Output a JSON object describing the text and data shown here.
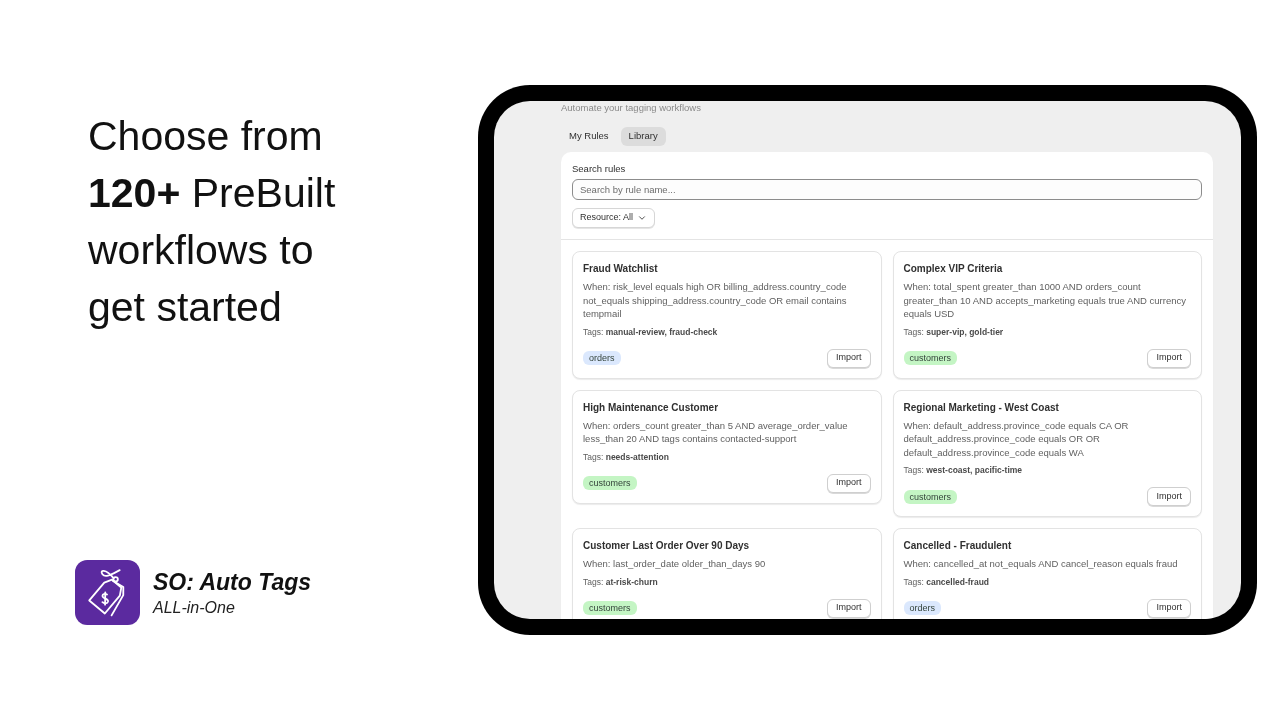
{
  "promo": {
    "headline": "Choose from **120+** PreBuilt workflows to get started"
  },
  "brand": {
    "name": "SO: Auto Tags",
    "tagline": "ALL-in-One"
  },
  "app": {
    "subtitle": "Automate your tagging workflows",
    "tabs": [
      {
        "label": "My Rules",
        "selected": false
      },
      {
        "label": "Library",
        "selected": true
      }
    ],
    "search": {
      "label": "Search rules",
      "placeholder": "Search by rule name..."
    },
    "filter": {
      "label": "Resource: All"
    },
    "rules": [
      {
        "title": "Fraud Watchlist",
        "condition": "When: risk_level equals high OR billing_address.country_code not_equals shipping_address.country_code OR email contains tempmail",
        "tags": "Tags: **manual-review, fraud-check**",
        "resource": {
          "label": "orders",
          "color": "#dbe8fd"
        },
        "action": "Import"
      },
      {
        "title": "Complex VIP Criteria",
        "condition": "When: total_spent greater_than 1000 AND orders_count greater_than 10 AND accepts_marketing equals true AND currency equals USD",
        "tags": "Tags: **super-vip, gold-tier**",
        "resource": {
          "label": "customers",
          "color": "#c4f5c4"
        },
        "action": "Import"
      },
      {
        "title": "High Maintenance Customer",
        "condition": "When: orders_count greater_than 5 AND average_order_value less_than 20 AND tags contains contacted-support",
        "tags": "Tags: **needs-attention**",
        "resource": {
          "label": "customers",
          "color": "#c4f5c4"
        },
        "action": "Import"
      },
      {
        "title": "Regional Marketing - West Coast",
        "condition": "When: default_address.province_code equals CA OR default_address.province_code equals OR OR default_address.province_code equals WA",
        "tags": "Tags: **west-coast, pacific-time**",
        "resource": {
          "label": "customers",
          "color": "#c4f5c4"
        },
        "action": "Import"
      },
      {
        "title": "Customer Last Order Over 90 Days",
        "condition": "When: last_order_date older_than_days 90",
        "tags": "Tags: **at-risk-churn**",
        "resource": {
          "label": "customers",
          "color": "#c4f5c4"
        },
        "action": "Import"
      },
      {
        "title": "Cancelled - Fraudulent",
        "condition": "When: cancelled_at not_equals AND cancel_reason equals fraud",
        "tags": "Tags: **cancelled-fraud**",
        "resource": {
          "label": "orders",
          "color": "#dbe8fd"
        },
        "action": "Import"
      }
    ]
  }
}
